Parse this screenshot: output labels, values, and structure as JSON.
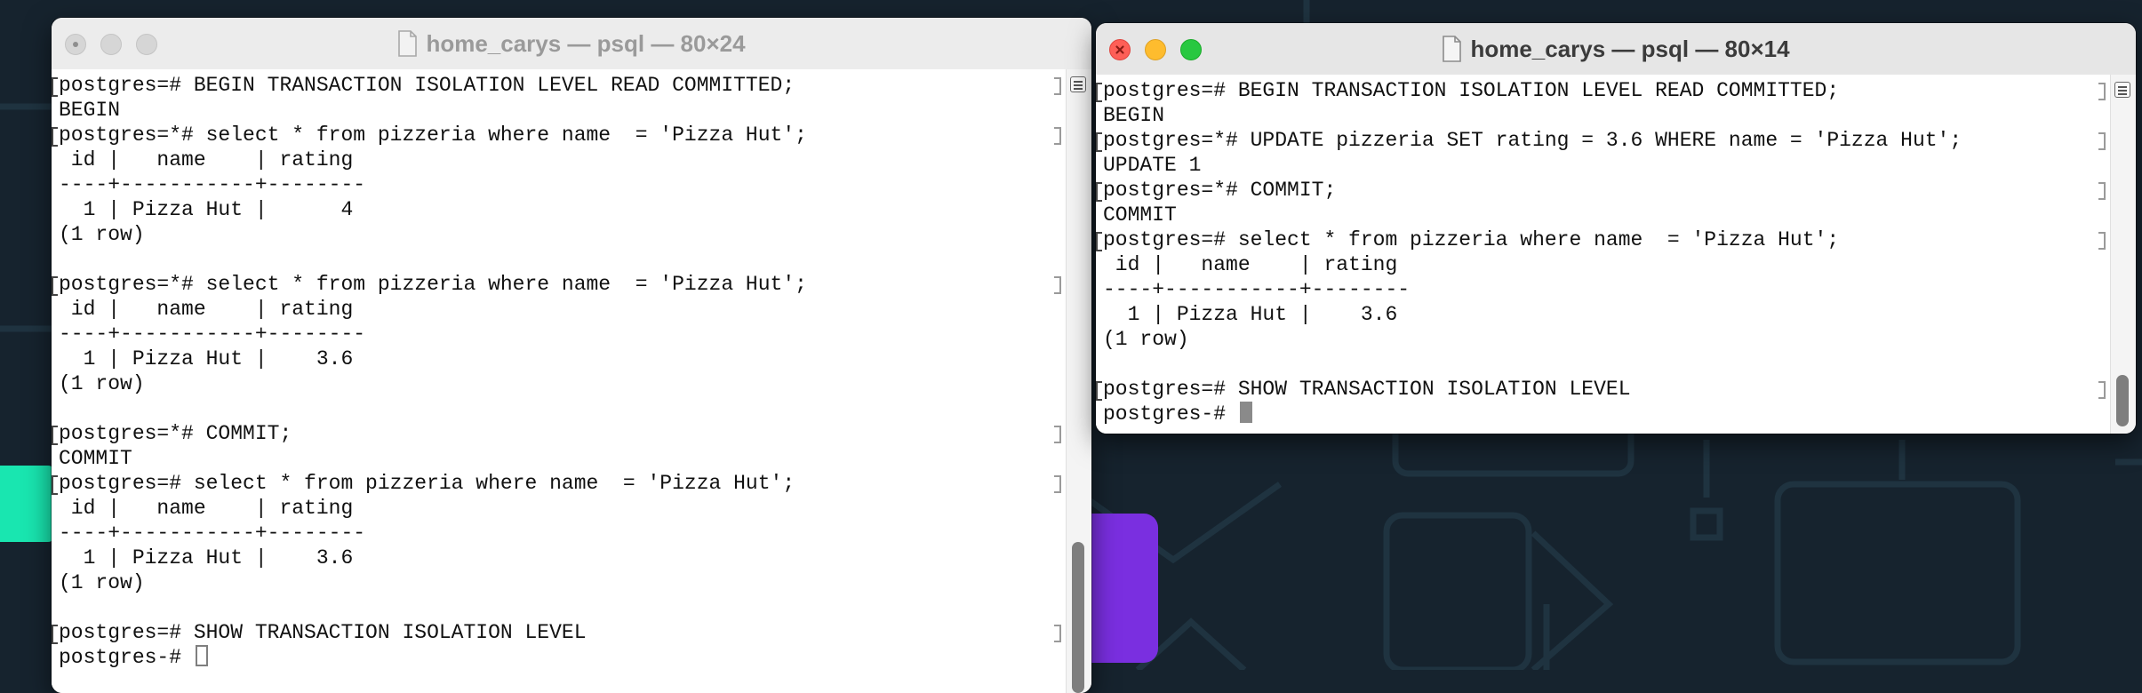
{
  "windows": {
    "left": {
      "title": "home_carys — psql — 80×24",
      "focused": false,
      "lines": [
        "postgres=# BEGIN TRANSACTION ISOLATION LEVEL READ COMMITTED;",
        "BEGIN",
        "postgres=*# select * from pizzeria where name  = 'Pizza Hut';",
        " id |   name    | rating",
        "----+-----------+--------",
        "  1 | Pizza Hut |      4",
        "(1 row)",
        "",
        "postgres=*# select * from pizzeria where name  = 'Pizza Hut';",
        " id |   name    | rating",
        "----+-----------+--------",
        "  1 | Pizza Hut |    3.6",
        "(1 row)",
        "",
        "postgres=*# COMMIT;",
        "COMMIT",
        "postgres=# select * from pizzeria where name  = 'Pizza Hut';",
        " id |   name    | rating",
        "----+-----------+--------",
        "  1 | Pizza Hut |    3.6",
        "(1 row)",
        "",
        "postgres=# SHOW TRANSACTION ISOLATION LEVEL",
        "postgres-# "
      ]
    },
    "right": {
      "title": "home_carys — psql — 80×14",
      "focused": true,
      "lines": [
        "postgres=# BEGIN TRANSACTION ISOLATION LEVEL READ COMMITTED;",
        "BEGIN",
        "postgres=*# UPDATE pizzeria SET rating = 3.6 WHERE name = 'Pizza Hut';",
        "UPDATE 1",
        "postgres=*# COMMIT;",
        "COMMIT",
        "postgres=# select * from pizzeria where name  = 'Pizza Hut';",
        " id |   name    | rating",
        "----+-----------+--------",
        "  1 | Pizza Hut |    3.6",
        "(1 row)",
        "",
        "postgres=# SHOW TRANSACTION ISOLATION LEVEL",
        "postgres-# "
      ]
    }
  },
  "colors": {
    "desktop": "#16232e",
    "accent_green": "#19e6b0",
    "accent_purple": "#7a2fe0",
    "close_red": "#fe5f57",
    "minimize_yellow": "#febc2e",
    "zoom_green": "#28c840"
  },
  "icons": {
    "window_title": "document-icon",
    "scroll_menu": "scrollbar-menu-icon"
  }
}
